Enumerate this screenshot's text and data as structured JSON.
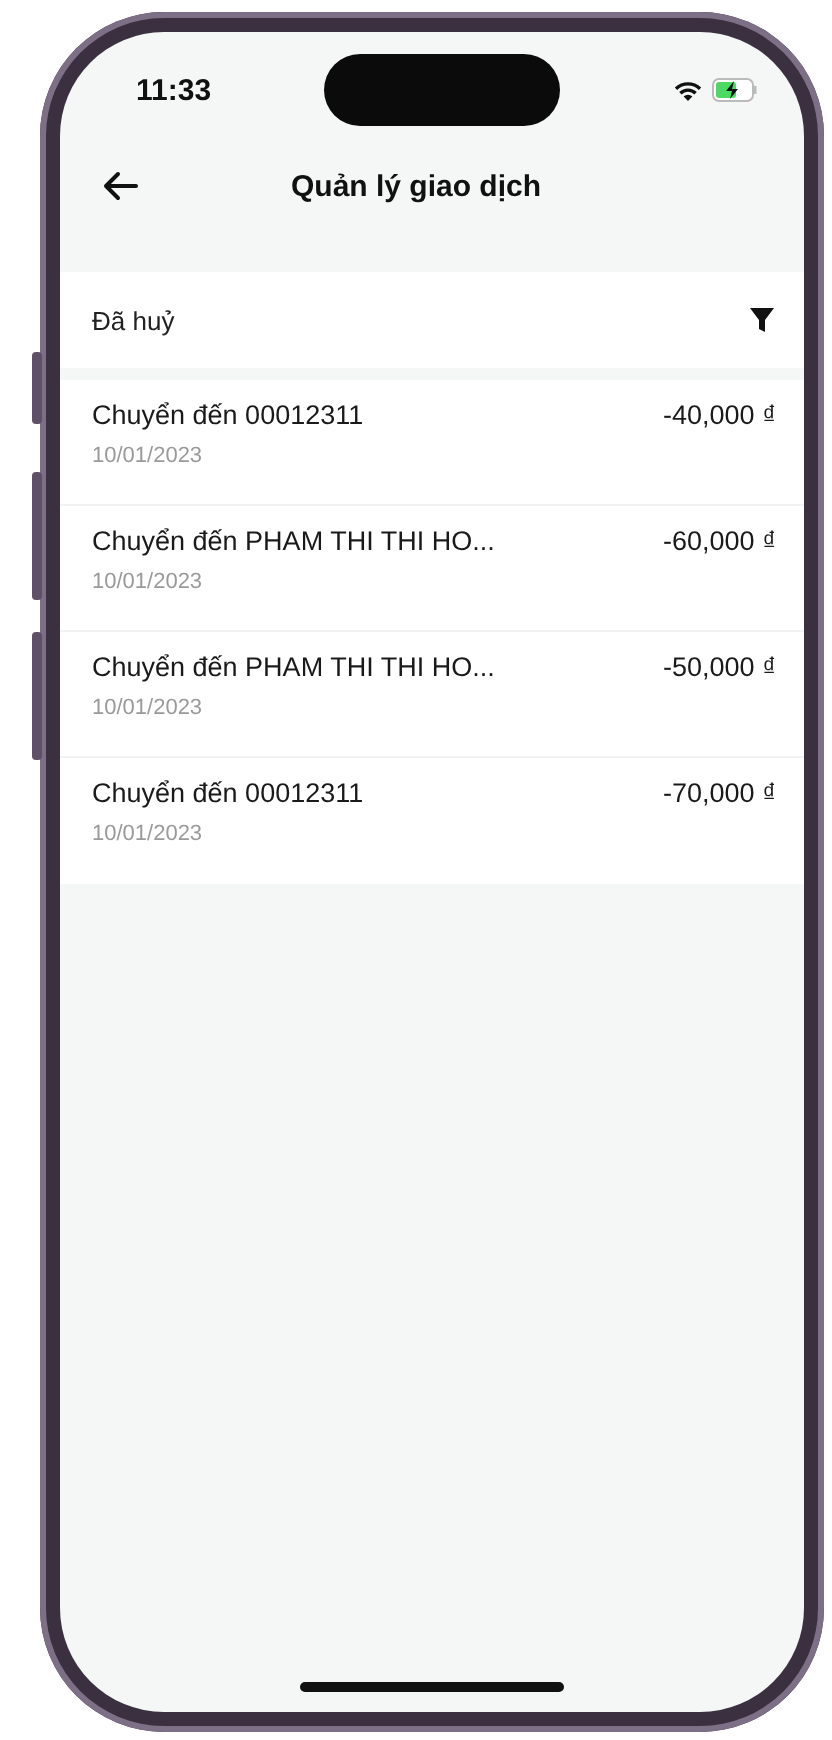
{
  "status_bar": {
    "time": "11:33"
  },
  "header": {
    "title": "Quản lý giao dịch"
  },
  "filter": {
    "label": "Đã huỷ"
  },
  "transactions": [
    {
      "title": "Chuyển đến 00012311",
      "date": "10/01/2023",
      "amount": "-40,000 ₫"
    },
    {
      "title": "Chuyển đến PHAM THI THI HO...",
      "date": "10/01/2023",
      "amount": "-60,000 ₫"
    },
    {
      "title": "Chuyển đến PHAM THI THI HO...",
      "date": "10/01/2023",
      "amount": "-50,000 ₫"
    },
    {
      "title": "Chuyển đến 00012311",
      "date": "10/01/2023",
      "amount": "-70,000 ₫"
    }
  ]
}
